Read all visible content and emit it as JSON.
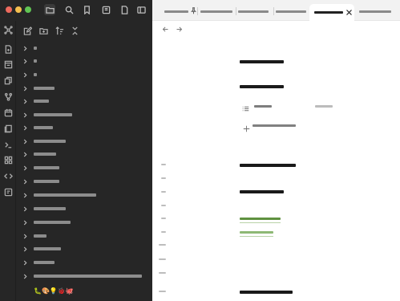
{
  "window": {
    "traffic_lights": [
      "close",
      "minimize",
      "zoom"
    ]
  },
  "top_toolbar": {
    "icons": [
      "folder-icon",
      "search-icon",
      "bookmark-icon",
      "book-icon",
      "file-icon",
      "sidebar-toggle-icon"
    ]
  },
  "ribbon": {
    "icons": [
      "graph-icon",
      "new-note-icon",
      "canvas-icon",
      "copy-icon",
      "git-branch-icon",
      "calendar-icon",
      "pages-icon",
      "terminal-icon",
      "grid-icon",
      "code-icon",
      "template-icon"
    ]
  },
  "explorer_toolbar": {
    "icons": [
      "new-note-icon",
      "new-folder-icon",
      "sort-icon",
      "collapse-icon"
    ]
  },
  "file_tree": {
    "items": [
      {
        "label": "■■"
      },
      {
        "label": "■■"
      },
      {
        "label": "■■"
      },
      {
        "label": "■■■■■■■■■■"
      },
      {
        "label": "■■■■■■■"
      },
      {
        "label": "■■■■■■■■■■■■■■■■■■■■"
      },
      {
        "label": "■■■■■■■■■■"
      },
      {
        "label": "■■■■■■■■■■■■■■■■"
      },
      {
        "label": "■■■■■■■■■■■■"
      },
      {
        "label": "■■■■■■■■■■■■■"
      },
      {
        "label": "■■■■■■■■■■■■■"
      },
      {
        "label": "■■■■■■■■■■■■■■■■■■■■■■■■■■■■■■■■■■■"
      },
      {
        "label": "■■■■■■■■■■■■■■■■■"
      },
      {
        "label": "■■■■■■■■■■■■■■■■■■■"
      },
      {
        "label": "■■■■■■■"
      },
      {
        "label": "■■■■■■■■■■■■■■■"
      },
      {
        "label": "■■■■■■■■■■■■"
      },
      {
        "label": "■■■■■■■■■■■■■■■■■■■■■■■■■■■■■■■■■■■■■■■■■■■■■■■■■■■■■"
      }
    ],
    "emoji_row": "🐛🎨💡🐞🐙"
  },
  "tabs": {
    "items": [
      {
        "label": "■■■■■■■■■■■■■■■■■■■■■■■■",
        "pinned": true
      },
      {
        "label": "■■■■■■■■■■■■■■■■■■■■■■■■"
      },
      {
        "label": "■■■■■■■■■■■■■■■■■"
      },
      {
        "label": "■■■■■■■■■■■■■■■■■■"
      },
      {
        "label": "■■■■■■■■■■■■■■■■■■■",
        "active": true
      },
      {
        "label": "■■■■■■■■■■■■■■■■■■■■■"
      }
    ]
  },
  "note": {
    "title": "■■■■■■■■■■■■■■■■",
    "heading": "■■■■■■■■■■■■■■■■■■■■",
    "property_name": "■■■■■■■",
    "property_value": "■■■■■■",
    "add_property_label": "■■■■ ■■■■■■■■",
    "lines": [
      "■■■■ ■■■■■■■■■■■■",
      "■■■■■■■■■■■■■■■■■■■■■",
      "■■■■■■■■■■■■■■■■■■",
      "■■■■■■■■■■■■■■■",
      "■■■■ ■■■■■■■■■■■"
    ]
  }
}
